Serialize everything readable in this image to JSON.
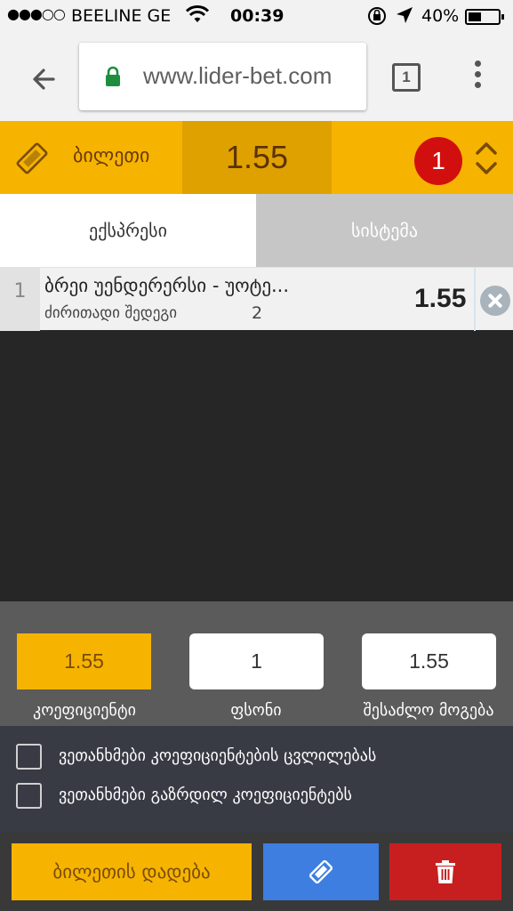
{
  "status_bar": {
    "signal": "●●●○○",
    "carrier": "BEELINE GE",
    "time": "00:39",
    "battery": "40%"
  },
  "browser": {
    "url": "www.lider-bet.com",
    "tab_count": "1",
    "icons": [
      "back-arrow-icon",
      "padlock-icon",
      "tab-switcher-icon",
      "more-vert-icon"
    ],
    "padlock_color": "#1e8e3e"
  },
  "ticket": {
    "title": "ბილეთი",
    "total_odds": "1.55",
    "bet_count": "1",
    "colors": {
      "accent": "#f6b400",
      "odds_bg": "#dfa100",
      "badge": "#d20f0f"
    }
  },
  "tabs": [
    {
      "label": "ექსპრესი",
      "active": true
    },
    {
      "label": "სისტემა",
      "active": false
    }
  ],
  "bets": [
    {
      "index": "1",
      "event": "ბრეი უენდერერსი - უოტე...",
      "market": "ძირითადი შედეგი",
      "outcome": "2",
      "odds": "1.55"
    }
  ],
  "summary": {
    "coefficient": {
      "value": "1.55",
      "label": "კოეფიციენტი"
    },
    "stake": {
      "value": "1",
      "label": "ფსონი"
    },
    "possible_win": {
      "value": "1.55",
      "label": "შესაძლო მოგება"
    }
  },
  "agreements": [
    {
      "label": "ვეთანხმები კოეფიციენტების ცვლილებას",
      "checked": false
    },
    {
      "label": "ვეთანხმები გაზრდილ კოეფიციენტებს",
      "checked": false
    }
  ],
  "actions": {
    "place_bet": "ბილეთის დადება",
    "colors": {
      "place": "#f6b400",
      "ticket": "#3d7ee0",
      "delete": "#c71f1f"
    }
  }
}
